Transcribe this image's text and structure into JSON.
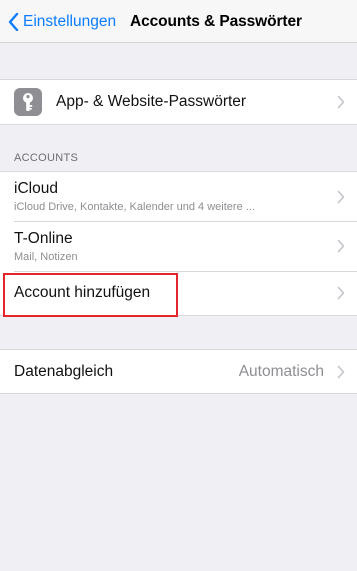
{
  "navbar": {
    "back_label": "Einstellungen",
    "title": "Accounts & Passwörter"
  },
  "passwords": {
    "label": "App- & Website-Passwörter",
    "icon": "key-icon"
  },
  "accounts_section": {
    "header": "ACCOUNTS",
    "items": [
      {
        "label": "iCloud",
        "sub": "iCloud Drive, Kontakte, Kalender und 4 weitere ..."
      },
      {
        "label": "T-Online",
        "sub": "Mail, Notizen"
      }
    ],
    "add_label": "Account hinzufügen"
  },
  "sync": {
    "label": "Datenabgleich",
    "value": "Automatisch"
  },
  "colors": {
    "accent": "#0a7cff",
    "highlight": "#e3262b",
    "background": "#efeff4"
  }
}
